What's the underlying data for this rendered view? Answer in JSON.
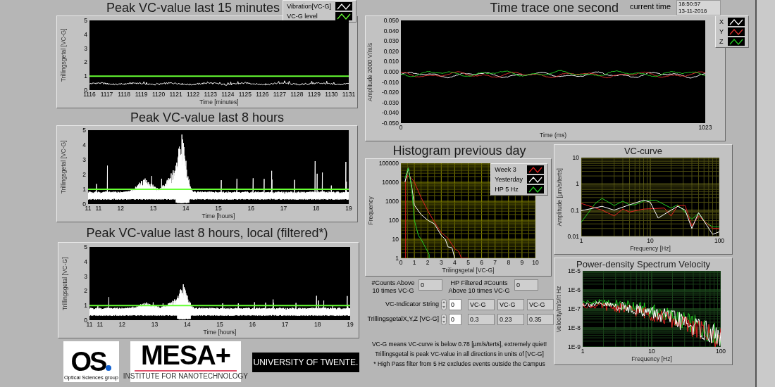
{
  "left_charts": [
    {
      "kind": "minutes",
      "title": "Peak VC-value last 15 minutes",
      "ylabel": "Trillingsgetal [VC-G]",
      "xlabel": "Time [minutes]",
      "yticks": [
        "5",
        "4",
        "3",
        "2",
        "1",
        "0"
      ],
      "xticks": [
        "1116",
        "1117",
        "1118",
        "1119",
        "1120",
        "1121",
        "1122",
        "1123",
        "1124",
        "1125",
        "1126",
        "1127",
        "1128",
        "1129",
        "1130",
        "1131"
      ],
      "legend": [
        {
          "label": "Vibration[VC-G]",
          "color": "#ffffff"
        },
        {
          "label": "VC-G level",
          "color": "#66ff33"
        }
      ]
    },
    {
      "kind": "hours",
      "title": "Peak VC-value last 8 hours",
      "ylabel": "Trillingsgetal [VC-G]",
      "xlabel": "Time [hours]",
      "yticks": [
        "5",
        "4",
        "3",
        "2",
        "1",
        "0"
      ],
      "xticks": [
        "11",
        "11",
        "12",
        "13",
        "14",
        "15",
        "16",
        "17",
        "18",
        "19"
      ]
    },
    {
      "kind": "filtered",
      "title": "Peak VC-value last 8 hours, local (filtered*)",
      "ylabel": "Trillingsgetal [VC-G]",
      "xlabel": "Time [hours]",
      "yticks": [
        "5",
        "4",
        "3",
        "2",
        "1",
        "0"
      ],
      "xticks": [
        "11",
        "11",
        "12",
        "13",
        "14",
        "15",
        "16",
        "17",
        "18",
        "19"
      ]
    }
  ],
  "logos": {
    "os_mark": "OS",
    "os_caption": "Optical Sciences group",
    "mesa_mark": "MESA+",
    "mesa_caption": "INSTITUTE FOR NANOTECHNOLOGY",
    "twente_mark": "UNIVERSITY OF TWENTE."
  },
  "time_trace": {
    "kind": "trace",
    "title": "Time trace one second",
    "ylabel": "Amplitude 2000 V/m/s",
    "xlabel": "Time (ms)",
    "yticks": [
      "0.050",
      "0.040",
      "0.030",
      "0.020",
      "0.010",
      "0.000",
      "-0.010",
      "-0.020",
      "-0.030",
      "-0.040",
      "-0.050"
    ],
    "xticks": [
      "0",
      "1023"
    ],
    "legend": [
      {
        "label": "X",
        "color": "#ffffff"
      },
      {
        "label": "Y",
        "color": "#e03030"
      },
      {
        "label": "Z",
        "color": "#22cc22"
      }
    ]
  },
  "current_time": {
    "label": "current time",
    "time": "18:50:57",
    "date": "13-11-2016"
  },
  "histogram": {
    "kind": "histogram",
    "title": "Histogram previous day",
    "ylabel": "Frequency",
    "xlabel": "Trilingsgetal [VC-G]",
    "yticks": [
      "100000",
      "10000",
      "1000",
      "100",
      "10",
      "1"
    ],
    "xticks": [
      "0",
      "1",
      "2",
      "3",
      "4",
      "5",
      "6",
      "7",
      "8",
      "9",
      "10"
    ],
    "legend": [
      {
        "label": "Week 3",
        "color": "#e02020"
      },
      {
        "label": "Yesterday",
        "color": "#ffffff"
      },
      {
        "label": "HP 5 Hz",
        "color": "#22cc22"
      }
    ]
  },
  "counts": [
    {
      "label": "#Counts Above 10 times VC-G",
      "value": "0"
    },
    {
      "label": "HP Filtered #Counts Above 10 times VC-G",
      "value": "0"
    }
  ],
  "indicators": [
    {
      "label": "VC-Indicator String",
      "index": "0",
      "values": [
        "VC-G",
        "VC-G",
        "VC-G"
      ]
    },
    {
      "label": "TrillingsgetalX,Y,Z [VC-G]",
      "index": "0",
      "values": [
        "0.3",
        "0.23",
        "0.35"
      ]
    }
  ],
  "notes": [
    "VC-G means VC-curve is below 0.78 [µm/s/terts], extremely quiet!",
    "Trillingsgetal is peak VC-value in all directions in units of [VC-G]",
    "* High Pass filter from 5 Hz excludes events outside  the Campus"
  ],
  "vc_curve": {
    "kind": "vc",
    "title": "VC-curve",
    "ylabel": "Amplitude [µm/s/terts]",
    "xlabel": "Frequency [Hz]",
    "yticks": [
      "10",
      "1",
      "0.1",
      "0.01"
    ],
    "xticks": [
      "1",
      "10",
      "100"
    ]
  },
  "psd": {
    "kind": "psd",
    "title": "Power-density Spectrum Velocity",
    "ylabel": "Velocity/m/s/rt Hz",
    "xlabel": "Frequency [Hz]",
    "yticks": [
      "1E-5",
      "1E-6",
      "1E-7",
      "1E-8",
      "1E-9"
    ],
    "xticks": [
      "1",
      "10",
      "100"
    ]
  }
}
